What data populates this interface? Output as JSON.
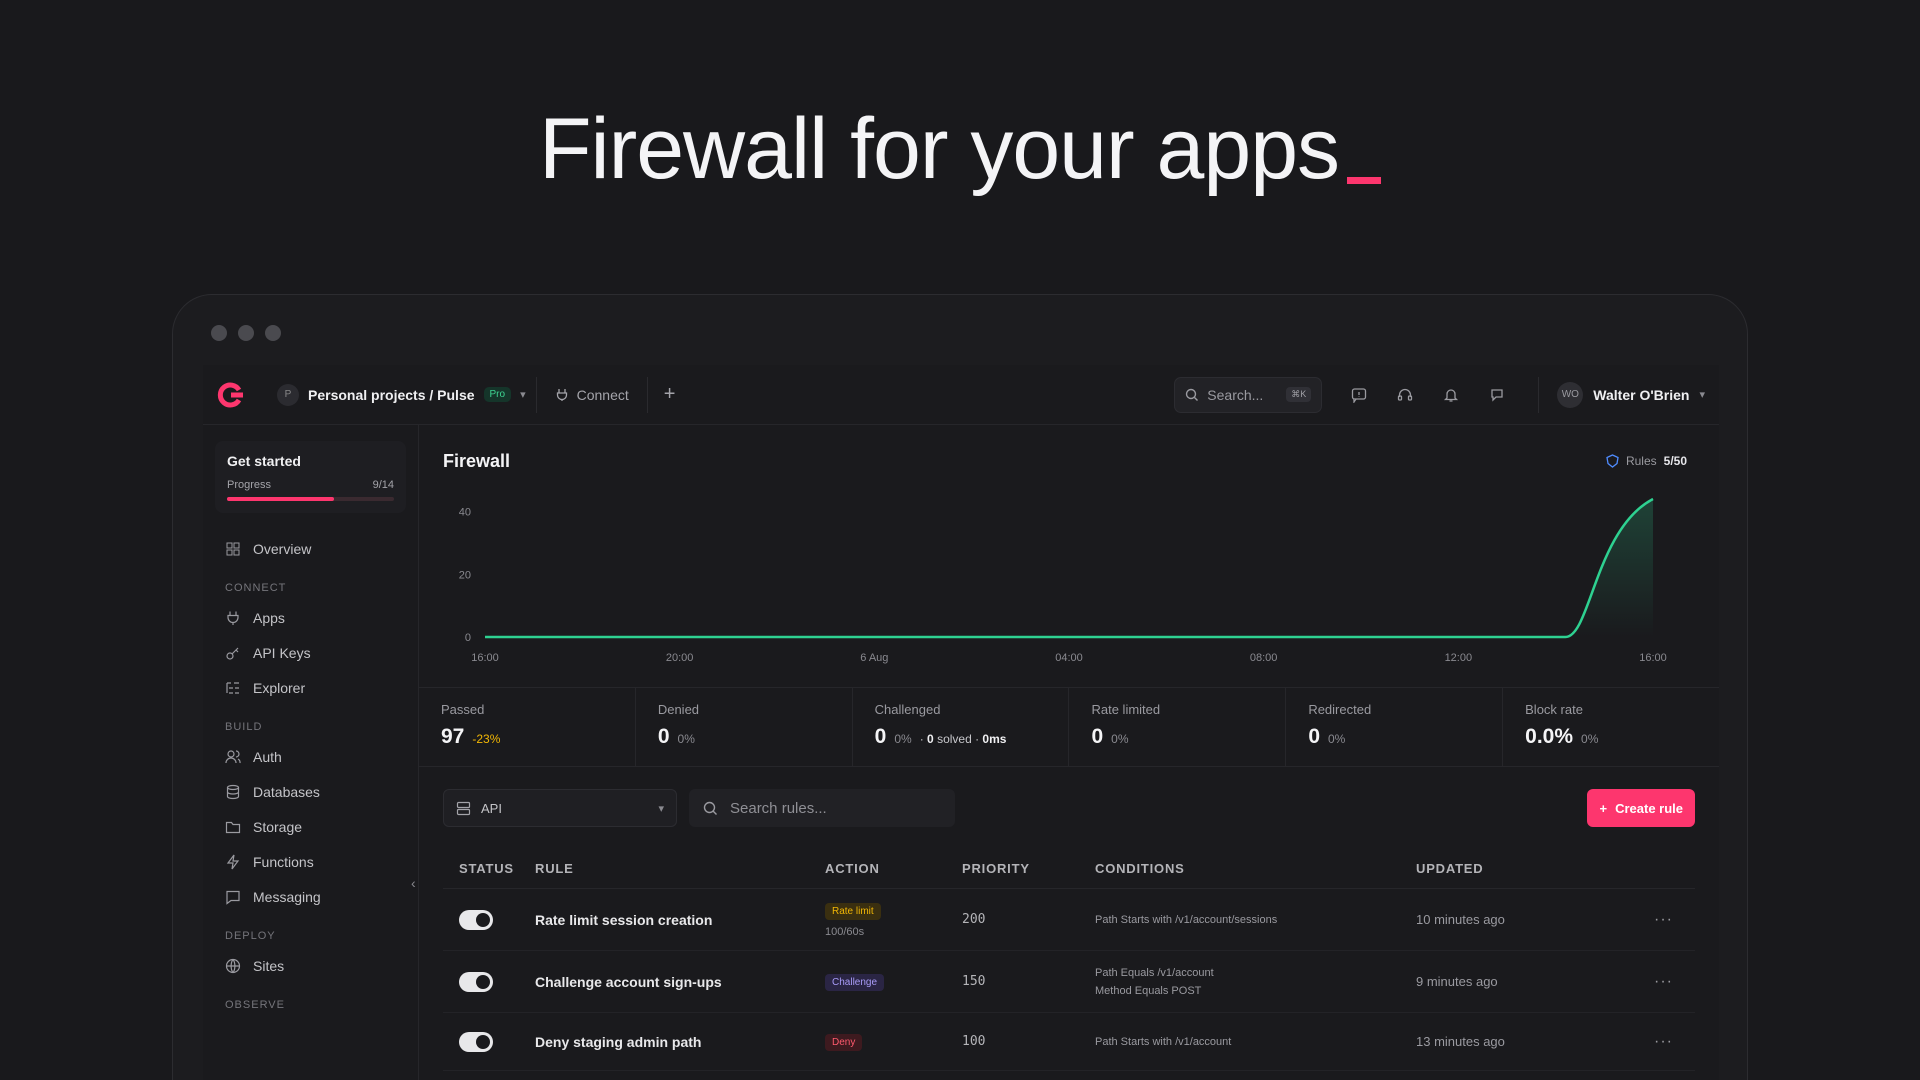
{
  "hero": {
    "title": "Firewall for your apps"
  },
  "topbar": {
    "project_initial": "P",
    "project": "Personal projects / Pulse",
    "plan_badge": "Pro",
    "connect": "Connect",
    "search_placeholder": "Search...",
    "search_shortcut": "⌘K",
    "user_initials": "WO",
    "user_name": "Walter O'Brien"
  },
  "sidebar": {
    "get_started": {
      "title": "Get started",
      "progress_label": "Progress",
      "progress_text": "9/14",
      "progress": 0.64
    },
    "overview": "Overview",
    "sections": [
      {
        "label": "CONNECT",
        "items": [
          "Apps",
          "API Keys",
          "Explorer"
        ]
      },
      {
        "label": "BUILD",
        "items": [
          "Auth",
          "Databases",
          "Storage",
          "Functions",
          "Messaging"
        ]
      },
      {
        "label": "DEPLOY",
        "items": [
          "Sites"
        ]
      },
      {
        "label": "OBSERVE",
        "items": []
      }
    ]
  },
  "firewall": {
    "title": "Firewall",
    "rules_label": "Rules",
    "rules_count": "5/50"
  },
  "chart_data": {
    "type": "line",
    "title": "",
    "xlabel": "",
    "ylabel": "",
    "x": [
      "16:00",
      "20:00",
      "6 Aug",
      "04:00",
      "08:00",
      "12:00",
      "16:00"
    ],
    "series": [
      {
        "values": [
          0,
          0,
          0,
          0,
          0,
          0,
          44
        ]
      }
    ],
    "yticks": [
      "0",
      "20",
      "40"
    ],
    "ylim": [
      0,
      44
    ],
    "line_color": "#2ed191"
  },
  "stats": [
    {
      "label": "Passed",
      "value": "97",
      "sub": "-23%"
    },
    {
      "label": "Denied",
      "value": "0",
      "sub": "0%"
    },
    {
      "label": "Challenged",
      "value": "0",
      "sub": "0%",
      "solved_value": "0",
      "solved_label": "solved",
      "time": "0ms"
    },
    {
      "label": "Rate limited",
      "value": "0",
      "sub": "0%"
    },
    {
      "label": "Redirected",
      "value": "0",
      "sub": "0%"
    },
    {
      "label": "Block rate",
      "value": "0.0%",
      "sub": "0%"
    }
  ],
  "toolbar": {
    "select_value": "API",
    "search_placeholder": "Search rules...",
    "create_label": "Create rule"
  },
  "table": {
    "headers": [
      "STATUS",
      "RULE",
      "ACTION",
      "PRIORITY",
      "CONDITIONS",
      "UPDATED"
    ],
    "rows": [
      {
        "rule": "Rate limit session creation",
        "action": "Rate limit",
        "action_sub": "100/60s",
        "priority": "200",
        "conditions": [
          "Path Starts with /v1/account/sessions"
        ],
        "updated": "10 minutes ago"
      },
      {
        "rule": "Challenge account sign-ups",
        "action": "Challenge",
        "action_sub": "",
        "priority": "150",
        "conditions": [
          "Path Equals /v1/account",
          "Method Equals POST"
        ],
        "updated": "9 minutes ago"
      },
      {
        "rule": "Deny staging admin path",
        "action": "Deny",
        "action_sub": "",
        "priority": "100",
        "conditions": [
          "Path Starts with /v1/account"
        ],
        "updated": "13 minutes ago"
      }
    ]
  },
  "colors": {
    "accent": "#fd366e",
    "chart": "#2ed191",
    "warning": "#f2b705"
  }
}
